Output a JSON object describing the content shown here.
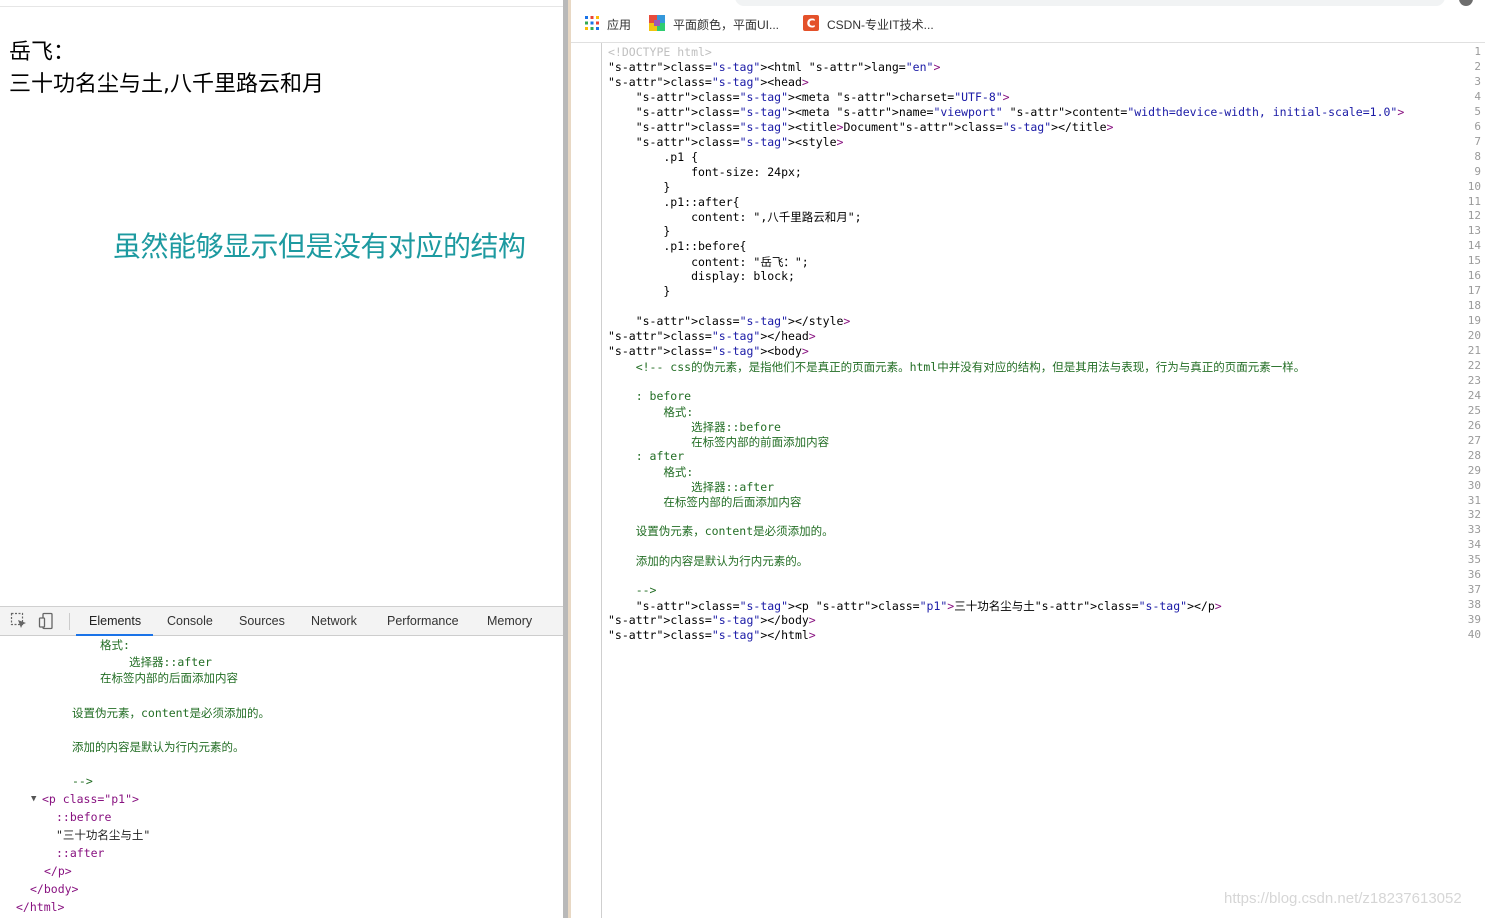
{
  "page": {
    "before_content": "岳飞：",
    "paragraph_text": "三十功名尘与土,八千里路云和月",
    "annotation": "虽然能够显示但是没有对应的结构"
  },
  "devtools": {
    "tabs": [
      "Elements",
      "Console",
      "Sources",
      "Network",
      "Performance",
      "Memory"
    ],
    "active_tab": "Elements",
    "dom_lines": [
      "格式:",
      "选择器::after",
      "在标签内部的后面添加内容",
      "设置伪元素，content是必须添加的。",
      "添加的内容是默认为行内元素的。",
      "-->",
      "<p class=\"p1\">",
      "::before",
      "\"三十功名尘与土\"",
      "::after",
      "</p>",
      "</body>",
      "</html>"
    ]
  },
  "bookmarks": [
    {
      "label": "应用",
      "icon": "apps-grid-icon"
    },
    {
      "label": "平面颜色，平面UI...",
      "icon": "flat-ui-colors-icon"
    },
    {
      "label": "CSDN-专业IT技术...",
      "icon": "csdn-icon"
    }
  ],
  "source": {
    "line_numbers": [
      "1",
      "2",
      "3",
      "4",
      "5",
      "6",
      "7",
      "8",
      "9",
      "10",
      "11",
      "12",
      "13",
      "14",
      "15",
      "16",
      "17",
      "18",
      "19",
      "20",
      "21",
      "22",
      "23",
      "24",
      "25",
      "26",
      "27",
      "28",
      "29",
      "30",
      "31",
      "32",
      "33",
      "34",
      "35",
      "36",
      "37",
      "38",
      "39",
      "40"
    ],
    "lines": [
      "<!DOCTYPE html>",
      "<html lang=\"en\">",
      "<head>",
      "    <meta charset=\"UTF-8\">",
      "    <meta name=\"viewport\" content=\"width=device-width, initial-scale=1.0\">",
      "    <title>Document</title>",
      "    <style>",
      "        .p1 {",
      "            font-size: 24px;",
      "        }",
      "        .p1::after{",
      "            content: \",八千里路云和月\";",
      "        }",
      "        .p1::before{",
      "            content: \"岳飞：\";",
      "            display: block;",
      "        }",
      "",
      "    </style>",
      "</head>",
      "<body>",
      "    <!-- css的伪元素，是指他们不是真正的页面元素。html中并没有对应的结构，但是其用法与表现，行为与真正的页面元素一样。",
      "",
      "    : before",
      "        格式:",
      "            选择器::before",
      "            在标签内部的前面添加内容",
      "    : after",
      "        格式:",
      "            选择器::after",
      "        在标签内部的后面添加内容",
      "",
      "    设置伪元素，content是必须添加的。",
      "",
      "    添加的内容是默认为行内元素的。",
      "",
      "    -->",
      "    <p class=\"p1\">三十功名尘与土</p>",
      "</body>",
      "</html>"
    ]
  },
  "watermark": "https://blog.csdn.net/z18237613052",
  "colors": {
    "annotation": "#1d9aa0",
    "tag": "#881280",
    "attr": "#994500",
    "value": "#1a1aa6",
    "comment": "#236e25",
    "active_tab_underline": "#1a73e8"
  }
}
